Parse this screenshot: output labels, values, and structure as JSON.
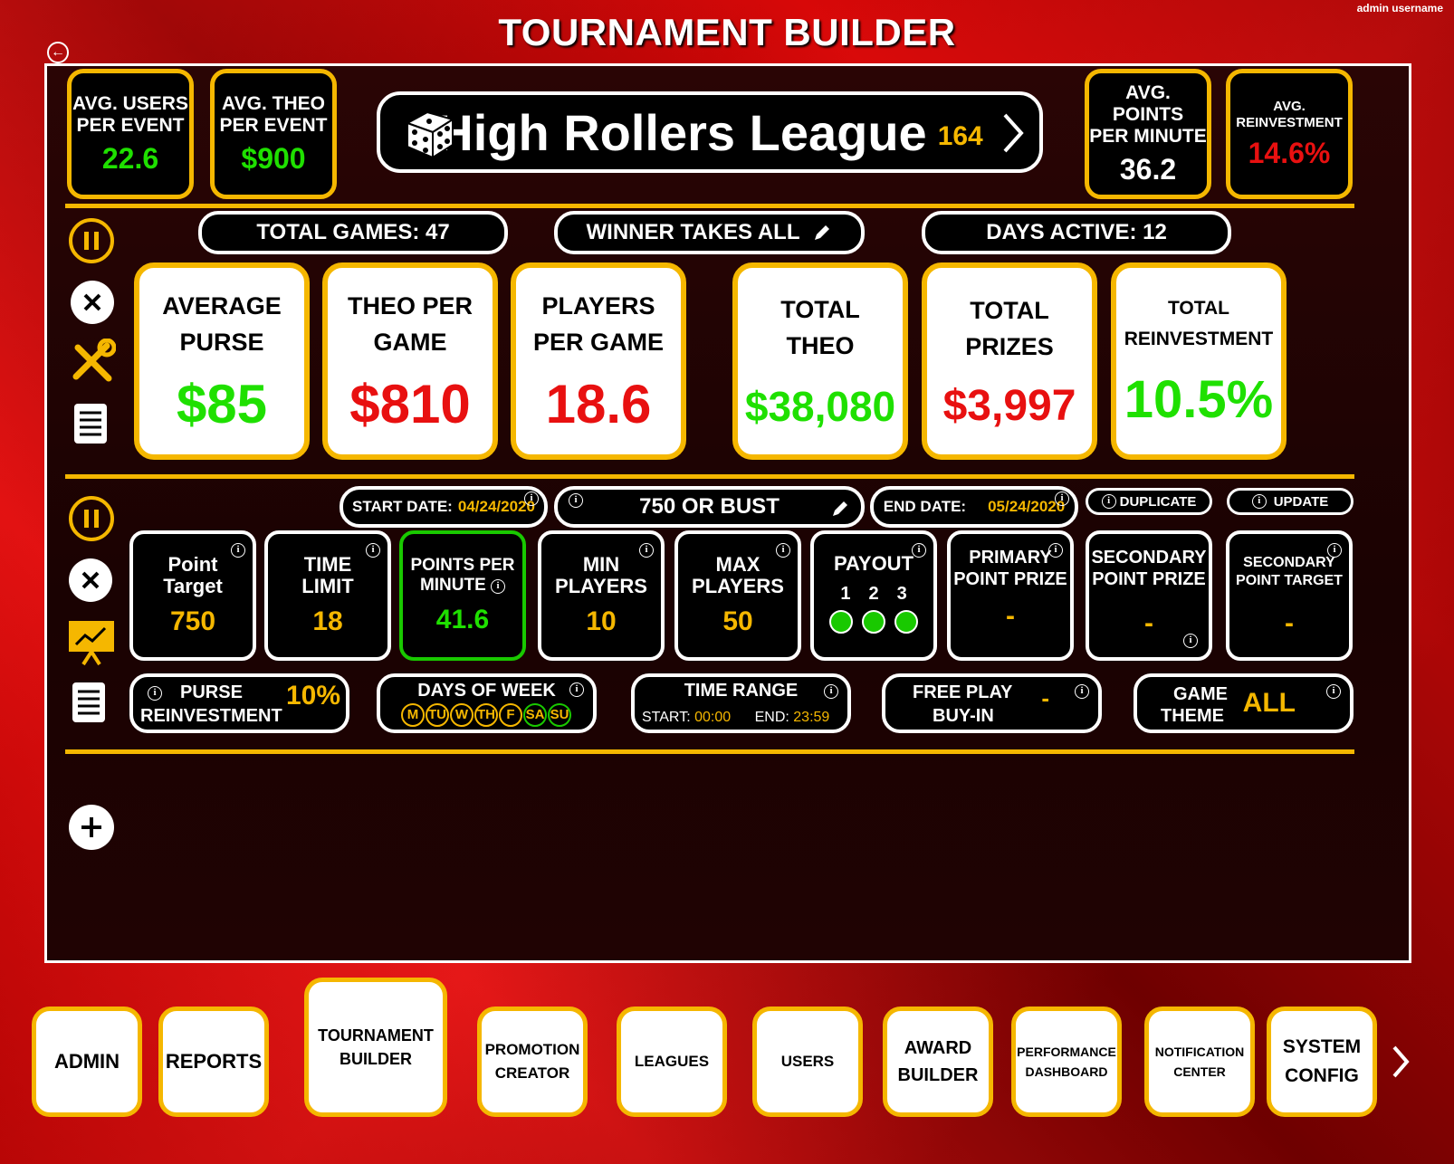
{
  "header": {
    "title": "TOURNAMENT BUILDER",
    "admin_user": "admin username",
    "back_icon": "back-arrow-icon"
  },
  "top_stats": {
    "avg_users": {
      "label1": "AVG. USERS",
      "label2": "PER EVENT",
      "value": "22.6"
    },
    "avg_theo": {
      "label1": "AVG. THEO",
      "label2": "PER EVENT",
      "value": "$900"
    },
    "avg_points": {
      "label1": "AVG. POINTS",
      "label2": "PER MINUTE",
      "value": "36.2"
    },
    "avg_reinvest": {
      "label1": "AVG.",
      "label2": "REINVESTMENT",
      "value": "14.6%"
    }
  },
  "league": {
    "name": "High Rollers League",
    "count": "164"
  },
  "summary": {
    "total_games": "TOTAL GAMES: 47",
    "mode": "WINNER TAKES ALL",
    "days_active": "DAYS ACTIVE: 12"
  },
  "big_cards": [
    {
      "l1": "AVERAGE",
      "l2": "PURSE",
      "value": "$85",
      "color": "#1fe000"
    },
    {
      "l1": "THEO PER",
      "l2": "GAME",
      "value": "$810",
      "color": "#e81010"
    },
    {
      "l1": "PLAYERS",
      "l2": "PER GAME",
      "value": "18.6",
      "color": "#e81010"
    },
    {
      "l1": "TOTAL",
      "l2": "THEO",
      "value": "$38,080",
      "color": "#1fe000"
    },
    {
      "l1": "TOTAL",
      "l2": "PRIZES",
      "value": "$3,997",
      "color": "#e81010"
    },
    {
      "l1": "TOTAL",
      "l2": "REINVESTMENT",
      "value": "10.5%",
      "color": "#1fe000"
    }
  ],
  "game": {
    "start_label": "START DATE:",
    "start_value": "04/24/2020",
    "name": "750 OR BUST",
    "end_label": "END DATE:",
    "end_value": "05/24/2020",
    "duplicate": "DUPLICATE",
    "update": "UPDATE",
    "cards": [
      {
        "l1": "Point",
        "l2": "Target",
        "value": "750"
      },
      {
        "l1": "TIME",
        "l2": "LIMIT",
        "value": "18"
      },
      {
        "l1": "POINTS PER",
        "l2": "MINUTE",
        "value": "41.6"
      },
      {
        "l1": "MIN",
        "l2": "PLAYERS",
        "value": "10"
      },
      {
        "l1": "MAX",
        "l2": "PLAYERS",
        "value": "50"
      },
      {
        "l1": "PAYOUT",
        "l2": "",
        "value": ""
      },
      {
        "l1": "PRIMARY",
        "l2": "POINT PRIZE",
        "value": "-"
      },
      {
        "l1": "SECONDARY",
        "l2": "POINT PRIZE",
        "value": "-"
      },
      {
        "l1": "SECONDARY",
        "l2": "POINT TARGET",
        "value": "-"
      }
    ],
    "payout_places": [
      "1",
      "2",
      "3"
    ],
    "purse_label1": "PURSE",
    "purse_label2": "REINVESTMENT",
    "purse_value": "10%",
    "dow_label": "DAYS OF WEEK",
    "days": [
      "M",
      "TU",
      "W",
      "TH",
      "F",
      "SA",
      "SU"
    ],
    "time_range_label": "TIME RANGE",
    "time_start_label": "START:",
    "time_start": "00:00",
    "time_end_label": "END:",
    "time_end": "23:59",
    "free_play_l1": "FREE PLAY",
    "free_play_l2": "BUY-IN",
    "free_play_value": "-",
    "theme_l1": "GAME",
    "theme_l2": "THEME",
    "theme_value": "ALL"
  },
  "nav": [
    {
      "label": "ADMIN"
    },
    {
      "label": "REPORTS"
    },
    {
      "label": "TOURNAMENT BUILDER"
    },
    {
      "label": "PROMOTION CREATOR"
    },
    {
      "label": "LEAGUES"
    },
    {
      "label": "USERS"
    },
    {
      "label": "AWARD BUILDER"
    },
    {
      "label": "PERFORMANCE DASHBOARD"
    },
    {
      "label": "NOTIFICATION CENTER"
    },
    {
      "label": "SYSTEM CONFIG"
    }
  ],
  "colors": {
    "gold": "#f5b700",
    "green": "#1fe000",
    "red": "#e81010"
  }
}
